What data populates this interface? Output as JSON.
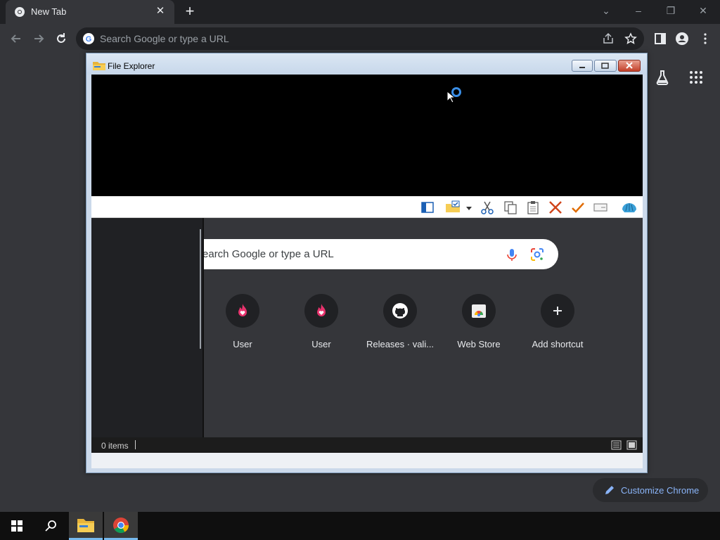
{
  "browser": {
    "tab": {
      "title": "New Tab"
    },
    "omnibox": {
      "placeholder": "Search Google or type a URL"
    },
    "customize_label": "Customize Chrome"
  },
  "file_explorer": {
    "title": "File Explorer",
    "status": "0 items",
    "ntp_search_text": "Search Google or type a URL",
    "shortcuts": [
      {
        "label": "User",
        "icon": "user-flame-icon"
      },
      {
        "label": "User",
        "icon": "user-flame-icon"
      },
      {
        "label": "Releases · vali...",
        "icon": "github-icon"
      },
      {
        "label": "Web Store",
        "icon": "web-store-icon"
      },
      {
        "label": "Add shortcut",
        "icon": "plus-icon"
      }
    ]
  },
  "colors": {
    "chrome_frame": "#202124",
    "chrome_surface": "#35363a",
    "accent_blue": "#8ab4f8",
    "flame_pink": "#e8336d"
  }
}
